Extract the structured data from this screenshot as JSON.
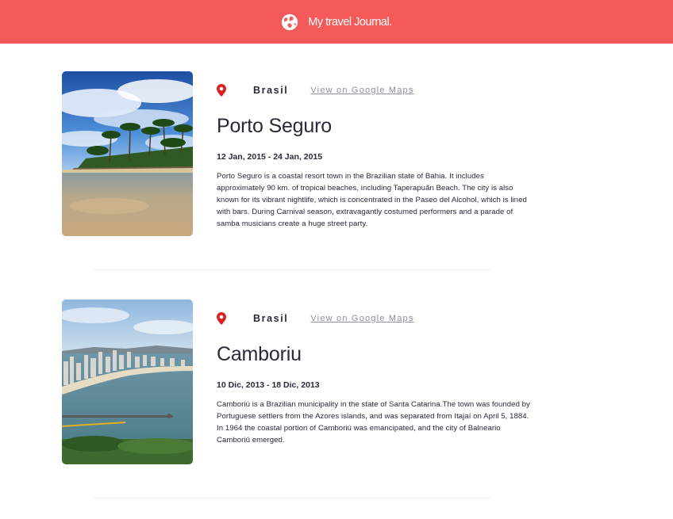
{
  "header": {
    "title": "My travel Journal.",
    "icon": "globe-icon",
    "color": "#f55a5a"
  },
  "entries": [
    {
      "country": "Brasil",
      "map_link": "View on Google Maps",
      "place": "Porto Seguro",
      "dates": "12 Jan, 2015 - 24 Jan, 2015",
      "description": "Porto Seguro is a coastal resort town in the Brazilian state of Bahia. It includes approximately 90 km. of tropical beaches, including Taperapuãn Beach. The city is also known for its vibrant nightlife, which is concentrated in the Paseo del Alcohol, which is lined with bars. During Carnival season, extravagantly costumed performers and a parade of samba musicians create a huge street party."
    },
    {
      "country": "Brasil",
      "map_link": "View on Google Maps",
      "place": "Camboriu",
      "dates": "10 Dic, 2013 - 18 Dic, 2013",
      "description": "Camboriú is a Brazilian municipality in the state of Santa Catarina.The town was founded by Portuguese settlers from the Azores islands, and was separated from Itajaí on April 5, 1884. In 1964 the coastal portion of Camboriú was emancipated, and the city of Balneario Camboriú emerged."
    }
  ]
}
